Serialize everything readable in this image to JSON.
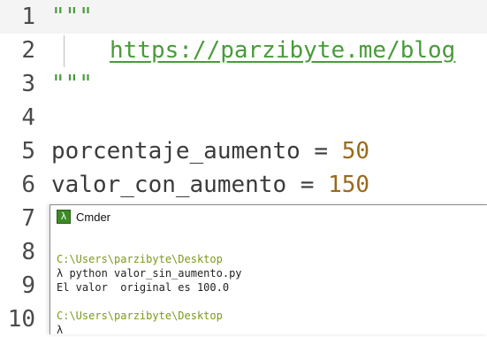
{
  "editor": {
    "lines": [
      {
        "number": "1",
        "text": "\"\"\""
      },
      {
        "number": "2",
        "text": "https://parzibyte.me/blog"
      },
      {
        "number": "3",
        "text": "\"\"\""
      },
      {
        "number": "4",
        "text": ""
      },
      {
        "number": "5",
        "name": "porcentaje_aumento",
        "op": " = ",
        "value": "50"
      },
      {
        "number": "6",
        "name": "valor_con_aumento",
        "op": " = ",
        "value": "150"
      },
      {
        "number": "7",
        "text": ""
      },
      {
        "number": "8",
        "text": ""
      },
      {
        "number": "9",
        "text": ""
      },
      {
        "number": "10",
        "text": ""
      }
    ]
  },
  "terminal": {
    "icon": "lambda-icon",
    "icon_glyph": "λ",
    "title": "Cmder",
    "lines": [
      "C:\\Users\\parzibyte\\Desktop",
      "λ python valor_sin_aumento.py",
      "El valor  original es 100.0",
      "",
      "C:\\Users\\parzibyte\\Desktop",
      "λ"
    ]
  },
  "colors": {
    "string": "#4a9a3c",
    "number": "#9a6a1a",
    "terminal_path": "#7a9a1a",
    "current_line": "#f4f4f4"
  }
}
